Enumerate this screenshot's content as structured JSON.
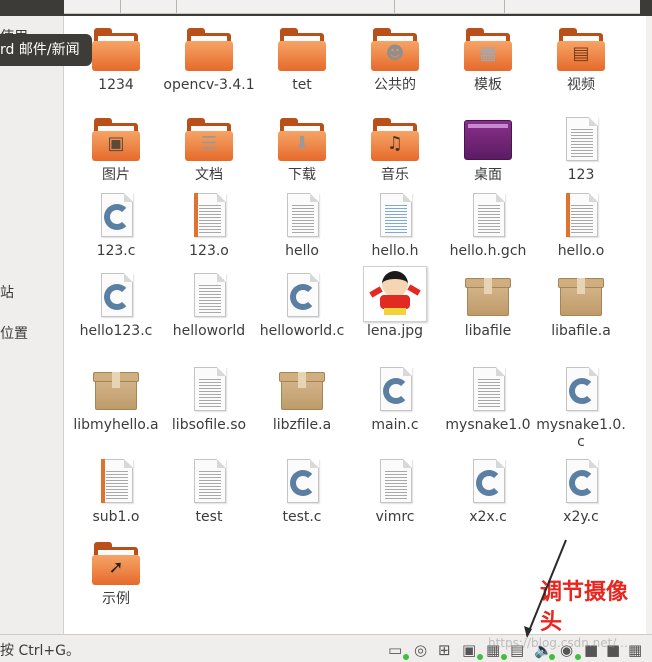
{
  "sidebar": {
    "items": [
      {
        "label": "使用"
      },
      {
        "label": "站"
      },
      {
        "label": "位置"
      }
    ],
    "tooltip": "rd 邮件/新闻"
  },
  "files": [
    {
      "name": "1234",
      "kind": "folder"
    },
    {
      "name": "opencv-3.4.1",
      "kind": "folder"
    },
    {
      "name": "tet",
      "kind": "folder"
    },
    {
      "name": "公共的",
      "kind": "folder-share"
    },
    {
      "name": "模板",
      "kind": "folder-templates"
    },
    {
      "name": "视频",
      "kind": "folder-video"
    },
    {
      "name": "图片",
      "kind": "folder-pictures"
    },
    {
      "name": "文档",
      "kind": "folder-documents"
    },
    {
      "name": "下载",
      "kind": "folder-download"
    },
    {
      "name": "音乐",
      "kind": "folder-music"
    },
    {
      "name": "桌面",
      "kind": "folder-desktop"
    },
    {
      "name": "123",
      "kind": "text"
    },
    {
      "name": "123.c",
      "kind": "c-source"
    },
    {
      "name": "123.o",
      "kind": "object"
    },
    {
      "name": "hello",
      "kind": "text"
    },
    {
      "name": "hello.h",
      "kind": "header"
    },
    {
      "name": "hello.h.gch",
      "kind": "text"
    },
    {
      "name": "hello.o",
      "kind": "object"
    },
    {
      "name": "hello123.c",
      "kind": "c-source"
    },
    {
      "name": "helloworld",
      "kind": "text"
    },
    {
      "name": "helloworld.c",
      "kind": "c-source"
    },
    {
      "name": "lena.jpg",
      "kind": "image"
    },
    {
      "name": "libafile",
      "kind": "package"
    },
    {
      "name": "libafile.a",
      "kind": "package"
    },
    {
      "name": "libmyhello.a",
      "kind": "package"
    },
    {
      "name": "libsofile.so",
      "kind": "text"
    },
    {
      "name": "libzfile.a",
      "kind": "package"
    },
    {
      "name": "main.c",
      "kind": "c-source"
    },
    {
      "name": "mysnake1.0",
      "kind": "text"
    },
    {
      "name": "mysnake1.0.c",
      "kind": "c-source"
    },
    {
      "name": "sub1.o",
      "kind": "object"
    },
    {
      "name": "test",
      "kind": "text"
    },
    {
      "name": "test.c",
      "kind": "c-source"
    },
    {
      "name": "vimrc",
      "kind": "text"
    },
    {
      "name": "x2x.c",
      "kind": "c-source"
    },
    {
      "name": "x2y.c",
      "kind": "c-source"
    },
    {
      "name": "示例",
      "kind": "folder-link"
    }
  ],
  "status_bar": {
    "text": "按 Ctrl+G。",
    "icons": [
      "hard-disk-icon",
      "optical-disc-icon",
      "usb-icon",
      "network-icon",
      "shared-folder-icon",
      "display-icon",
      "audio-icon",
      "webcam-icon",
      "recording-icon",
      "mouse-integration-icon",
      "host-key-icon"
    ]
  },
  "annotation": {
    "line1": "调节摄像",
    "line2": "头",
    "color": "#e8261f"
  },
  "watermark": "https://blog.csdn.net/..."
}
